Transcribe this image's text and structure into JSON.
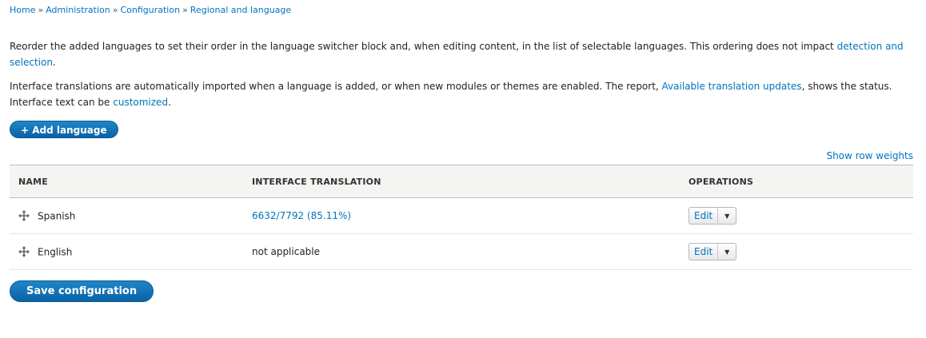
{
  "breadcrumb": {
    "items": [
      "Home",
      "Administration",
      "Configuration",
      "Regional and language"
    ],
    "separator": "»"
  },
  "intro": {
    "p1_text": "Reorder the added languages to set their order in the language switcher block and, when editing content, in the list of selectable languages. This ordering does not impact ",
    "p1_link": "detection and selection",
    "p1_end": ".",
    "p2_text_a": "Interface translations are automatically imported when a language is added, or when new modules or themes are enabled. The report, ",
    "p2_link_a": "Available translation updates",
    "p2_text_b": ", shows the status. Interface text can be ",
    "p2_link_b": "customized",
    "p2_end": "."
  },
  "add_language_button": "+ Add language",
  "show_row_weights": "Show row weights",
  "table": {
    "headers": [
      "NAME",
      "INTERFACE TRANSLATION",
      "OPERATIONS"
    ],
    "rows": [
      {
        "name": "Spanish",
        "translation": "6632/7792 (85.11%)",
        "translation_is_link": true,
        "operation": "Edit"
      },
      {
        "name": "English",
        "translation": "not applicable",
        "translation_is_link": false,
        "operation": "Edit"
      }
    ]
  },
  "save_button": "Save configuration",
  "colors": {
    "link": "#0074bd",
    "button": "#0a6eb4"
  }
}
